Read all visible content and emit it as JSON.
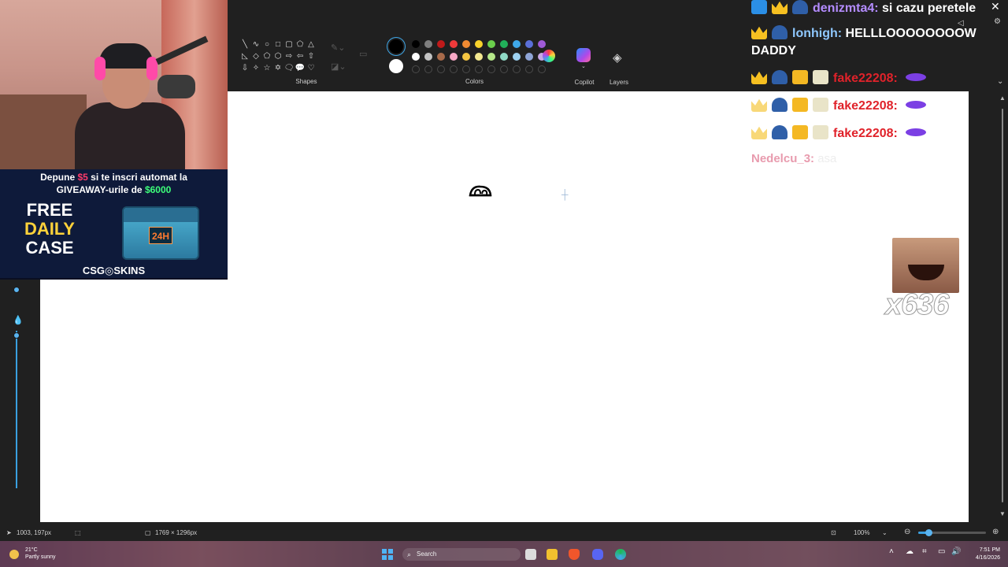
{
  "ribbon": {
    "groups": {
      "shapes": "Shapes",
      "colors": "Colors",
      "copilot": "Copilot",
      "layers": "Layers"
    },
    "palette_top": [
      "#000000",
      "#7f7f7f",
      "#c01a1a",
      "#ef3a3a",
      "#f08a32",
      "#f7d22b",
      "#6bcf4c",
      "#21b05a",
      "#3fa7e8",
      "#5a6fd8",
      "#a05ad6"
    ],
    "palette_bottom": [
      "#ffffff",
      "#c3c3c3",
      "#a86a4a",
      "#f7a9c5",
      "#f5c542",
      "#f3e890",
      "#b6e88a",
      "#8fd9c5",
      "#9dd1f0",
      "#8ea4d6",
      "#c7a8e6"
    ]
  },
  "status": {
    "cursor_pos": "1003, 197px",
    "canvas_size": "1769 × 1296px",
    "zoom": "100%",
    "zoom_slider_fraction": 0.15
  },
  "taskbar": {
    "temperature": "21°C",
    "weather": "Partly sunny",
    "search_placeholder": "Search",
    "time": "7:51 PM",
    "date": "4/16/2026"
  },
  "ad": {
    "line1_prefix": "Depune ",
    "line1_amount": "$5",
    "line1_suffix": " si te inscri automat la",
    "line2_prefix": "GIVEAWAY-urile de ",
    "line2_amount": "$6000",
    "free_l1": "FREE",
    "free_l2": "DAILY",
    "free_l3": "CASE",
    "chest_label": "24H",
    "brand": "CSG◎SKINS"
  },
  "chat": {
    "messages": [
      {
        "user": "denizmta4:",
        "text": "si cazu peretele",
        "user_color": "#b48cff"
      },
      {
        "user": "lonhigh:",
        "text": "HELLLOOOOOOOOW",
        "text2": "DADDY",
        "user_color": "#8fc8ff"
      },
      {
        "user": "fake22208:",
        "text": "",
        "user_color": "#e0222a"
      },
      {
        "user": "fake22208:",
        "text": "",
        "user_color": "#e0222a"
      },
      {
        "user": "fake22208:",
        "text": "",
        "user_color": "#e0222a"
      },
      {
        "user": "Nedelcu_3:",
        "text": "asa",
        "user_color": "#e58aa0"
      }
    ],
    "emote_combo": "x636"
  }
}
